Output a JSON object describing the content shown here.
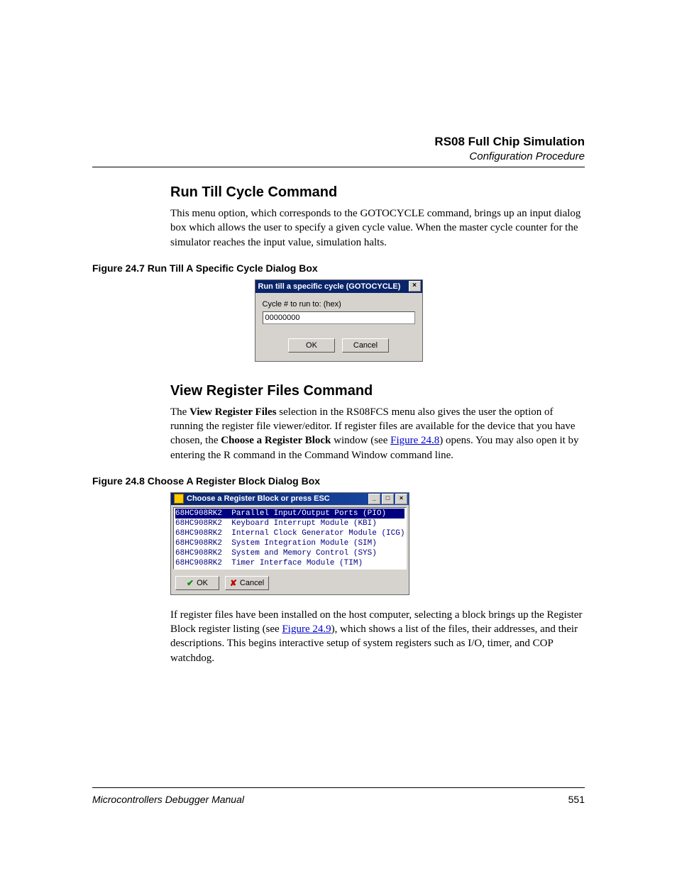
{
  "header": {
    "title": "RS08 Full Chip Simulation",
    "subtitle": "Configuration Procedure"
  },
  "section1": {
    "heading": "Run Till Cycle Command",
    "paragraph": "This menu option, which corresponds to the GOTOCYCLE command, brings up an input dialog box which allows the user to specify a given cycle value. When the master cycle counter for the simulator reaches the input value, simulation halts."
  },
  "figure1": {
    "caption": "Figure 24.7  Run Till A Specific Cycle Dialog Box"
  },
  "dlg1": {
    "title": "Run till a specific cycle (GOTOCYCLE)",
    "close": "×",
    "label": "Cycle # to run to: (hex)",
    "value": "00000000",
    "ok": "OK",
    "cancel": "Cancel"
  },
  "section2": {
    "heading": "View Register Files Command",
    "p1a": "The ",
    "p1b": "View Register Files",
    "p1c": " selection in the RS08FCS menu also gives the user the option of running the register file viewer/editor. If register files are available for the device that you have chosen, the ",
    "p1d": "Choose a Register Block",
    "p1e": " window (see ",
    "p1link1": "Figure 24.8",
    "p1f": ") opens. You may also open it by entering the R command in the Command Window command line."
  },
  "figure2": {
    "caption": "Figure 24.8  Choose A Register Block Dialog Box"
  },
  "dlg2": {
    "title": "Choose a Register Block or press ESC",
    "min": "_",
    "max": "□",
    "close": "×",
    "rows": [
      {
        "col1": "68HC908RK2",
        "col2": "Parallel Input/Output Ports (PIO)",
        "sel": true
      },
      {
        "col1": "68HC908RK2",
        "col2": "Keyboard Interrupt Module (KBI)",
        "sel": false
      },
      {
        "col1": "68HC908RK2",
        "col2": "Internal Clock Generator Module (ICG)",
        "sel": false
      },
      {
        "col1": "68HC908RK2",
        "col2": "System Integration Module (SIM)",
        "sel": false
      },
      {
        "col1": "68HC908RK2",
        "col2": "System and Memory Control (SYS)",
        "sel": false
      },
      {
        "col1": "68HC908RK2",
        "col2": "Timer Interface Module (TIM)",
        "sel": false
      }
    ],
    "ok": "OK",
    "cancel": "Cancel"
  },
  "para_after": {
    "a": "If register files have been installed on the host computer, selecting a block brings up the Register Block register listing (see ",
    "link": "Figure 24.9",
    "b": "), which shows a list of the files, their addresses, and their descriptions. This begins interactive setup of system registers such as I/O, timer, and COP watchdog."
  },
  "footer": {
    "left": "Microcontrollers Debugger Manual",
    "right": "551"
  }
}
